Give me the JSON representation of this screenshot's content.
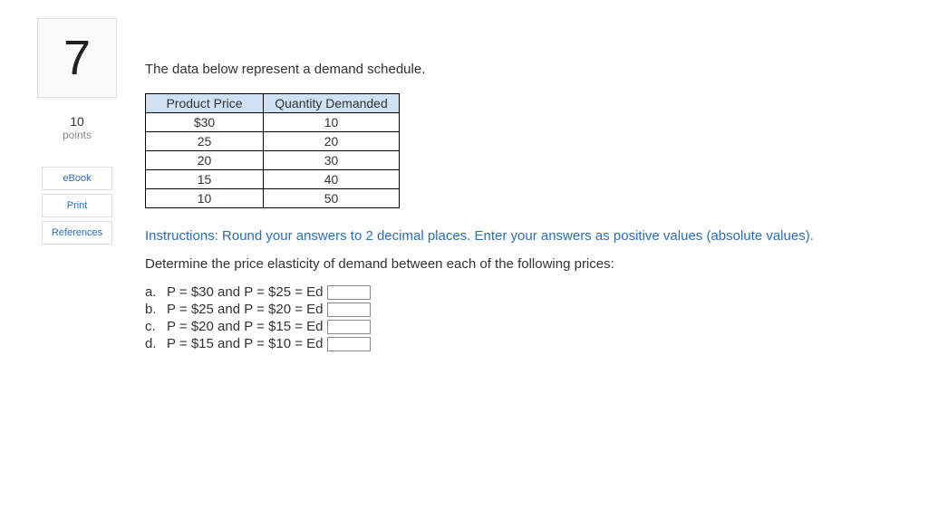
{
  "sidebar": {
    "question_number": "7",
    "points_value": "10",
    "points_label": "points",
    "buttons": {
      "ebook": "eBook",
      "print": "Print",
      "references": "References"
    }
  },
  "content": {
    "intro": "The data below represent a demand schedule.",
    "table": {
      "headers": {
        "price": "Product Price",
        "qty": "Quantity Demanded"
      },
      "rows": [
        {
          "price": "$30",
          "qty": "10"
        },
        {
          "price": "25",
          "qty": "20"
        },
        {
          "price": "20",
          "qty": "30"
        },
        {
          "price": "15",
          "qty": "40"
        },
        {
          "price": "10",
          "qty": "50"
        }
      ]
    },
    "instructions": "Instructions: Round your answers to 2 decimal places. Enter your answers as positive values (absolute values).",
    "determine": "Determine the price elasticity of demand between each of the following prices:",
    "items": [
      {
        "letter": "a.",
        "text": "P = $30 and P = $25 = Ed"
      },
      {
        "letter": "b.",
        "text": "P = $25 and P = $20 = Ed"
      },
      {
        "letter": "c.",
        "text": "P = $20 and P = $15 = Ed"
      },
      {
        "letter": "d.",
        "text": "P = $15 and P = $10 = Ed"
      }
    ]
  }
}
